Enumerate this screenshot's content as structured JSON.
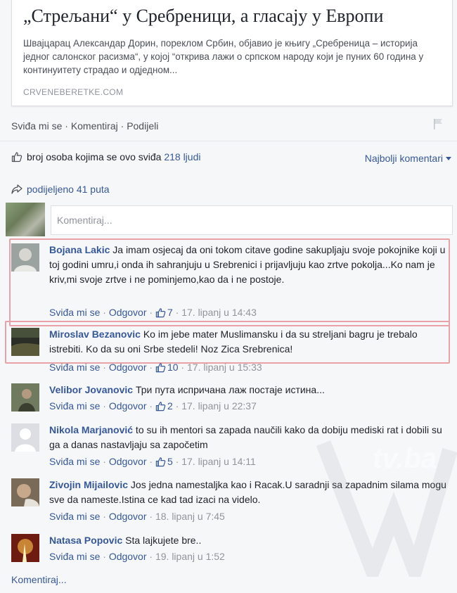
{
  "link_preview": {
    "title": "„Стрељани“ у Сребреници, а гласају у Европи",
    "description": "Швајцарац Александар Дорин, пореклом Србин, објавио је књигу „Сребреница – историја једног салонског расизма“, у којој “открива лажи о српском народу који је пуних 60 година у континуитету страдао и одједном...",
    "domain": "CRVENEBERETKE.COM"
  },
  "post_actions": {
    "like": "Sviđa mi se",
    "sep1": " · ",
    "comment": "Komentiraj",
    "sep2": " · ",
    "share": "Podijeli"
  },
  "likes_summary": {
    "prefix": "broj osoba kojima se ovo sviđa",
    "count": "218 ljudi"
  },
  "sort": {
    "label": "Najbolji komentari"
  },
  "shares": {
    "label": "podijeljeno 41 puta"
  },
  "composer": {
    "placeholder": "Komentiraj..."
  },
  "comments": [
    {
      "author": "Bojana Lakic",
      "text": " Ja imam osjecaj da oni tokom citave godine sakupljaju svoje pokojnike koji u toj godini umru,i onda ih sahranjuju u Srebrenici i prijavljuju kao zrtve pokolja...Ko nam je kriv,mi svoje zrtve i ne pominjemo,kao da i ne postoje.",
      "like_label": "Sviđa mi se",
      "reply_label": "Odgovor",
      "likes": "7",
      "time": "17. lipanj u 14:43"
    },
    {
      "author": "Miroslav Bezanovic",
      "text": " Ko im jebe mater Muslimansku i da su streljani bagru je trebalo istrebiti. Ko da su oni Srbe stedeli! Noz Zica Srebrenica!",
      "like_label": "Sviđa mi se",
      "reply_label": "Odgovor",
      "likes": "10",
      "time": "17. lipanj u 15:33"
    },
    {
      "author": "Velibor Jovanovic",
      "text": " Три пута испричана лаж постаје истина...",
      "like_label": "Sviđa mi se",
      "reply_label": "Odgovor",
      "likes": "2",
      "time": "17. lipanj u 22:37"
    },
    {
      "author": "Nikola Marjanović",
      "text": " to su ih mentori sa zapada naučili kako da dobiju mediski rat i dobili su ga a danas nastavljaju sa započetim",
      "like_label": "Sviđa mi se",
      "reply_label": "Odgovor",
      "likes": "5",
      "time": "17. lipanj u 14:11"
    },
    {
      "author": "Zivojin Mijailovic",
      "text": " Jos jedna namestaljka kao i Racak.U saradnji sa zapadnim silama mogu sve da namestе.Istina ce kad tad izaci na videlo.",
      "like_label": "Sviđa mi se",
      "reply_label": "Odgovor",
      "likes": "",
      "time": "18. lipanj u 7:45"
    },
    {
      "author": "Natasa Popovic",
      "text": " Sta lajkujete bre..",
      "like_label": "Sviđa mi se",
      "reply_label": "Odgovor",
      "likes": "",
      "time": "19. lipanj u 1:52"
    }
  ],
  "more_comments": "Komentiraj...",
  "watermark_text": "tv.ba",
  "colors": {
    "link": "#365899",
    "highlight_border": "#e8a2a8",
    "meta": "#90949c"
  }
}
